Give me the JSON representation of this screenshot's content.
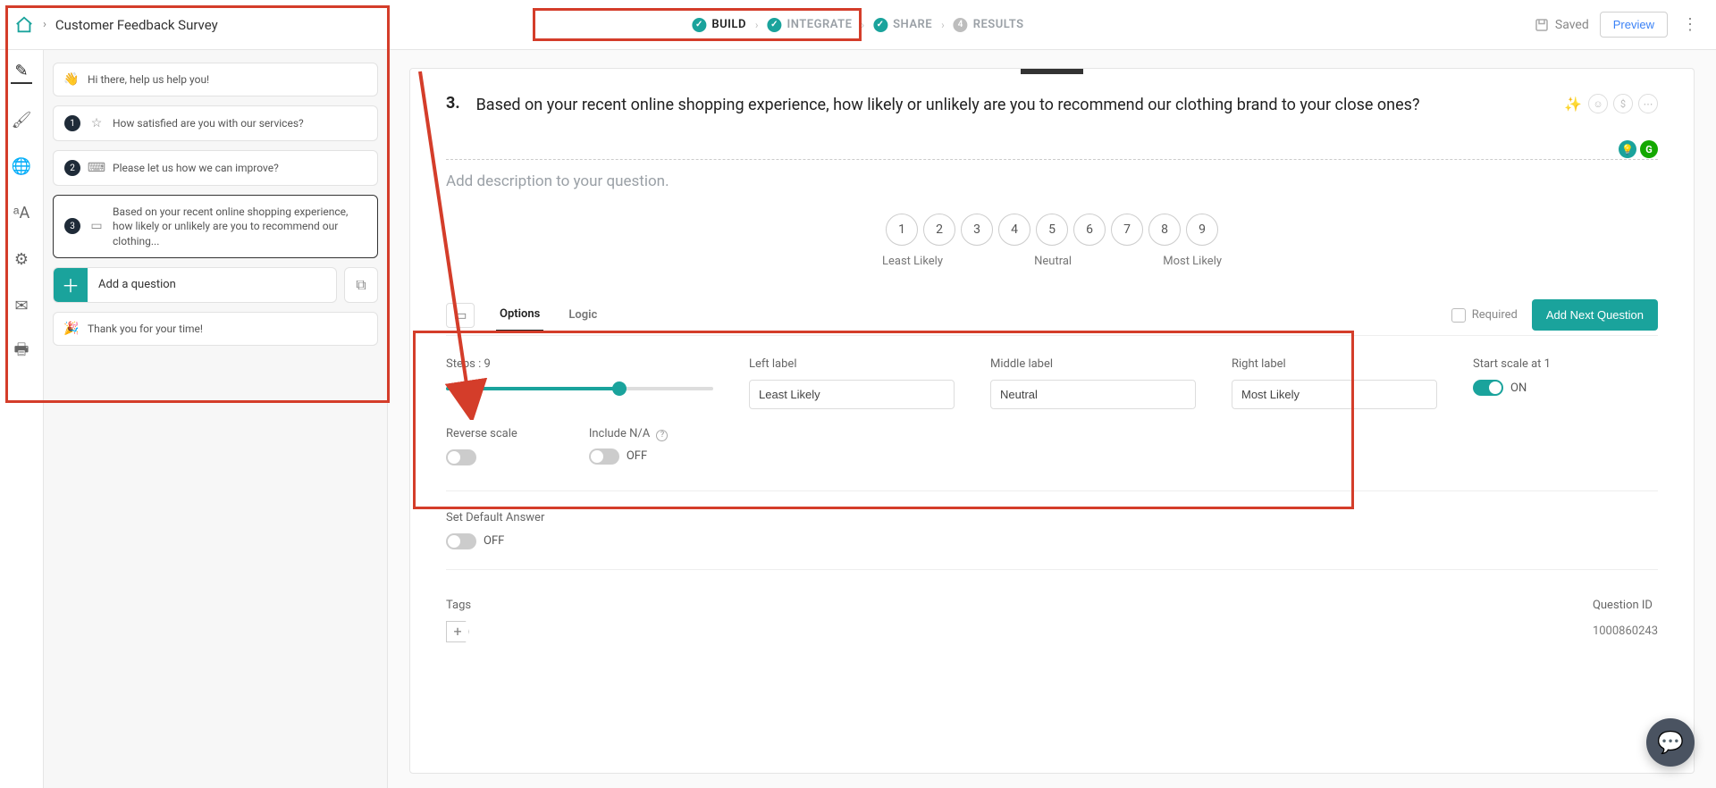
{
  "header": {
    "surveyTitle": "Customer Feedback Survey",
    "steps": [
      {
        "label": "BUILD",
        "active": true,
        "badge": "✓"
      },
      {
        "label": "INTEGRATE",
        "active": false,
        "badge": "✓"
      },
      {
        "label": "SHARE",
        "active": false,
        "badge": "✓"
      },
      {
        "label": "RESULTS",
        "active": false,
        "badge": "4"
      }
    ],
    "savedLabel": "Saved",
    "previewLabel": "Preview"
  },
  "sidebar": {
    "welcome": {
      "text": "Hi there, help us help you!"
    },
    "questions": [
      {
        "num": "1",
        "icon": "☆",
        "text": "How satisfied are you with our services?"
      },
      {
        "num": "2",
        "icon": "⌨",
        "text": "Please let us how we can improve?"
      },
      {
        "num": "3",
        "icon": "▭",
        "text": "Based on your recent online shopping experience, how likely or unlikely are you to recommend our clothing...",
        "selected": true
      }
    ],
    "addLabel": "Add a question",
    "thankyou": {
      "text": "Thank you for your time!"
    }
  },
  "editor": {
    "qNumber": "3.",
    "qText": "Based on your recent online shopping experience, how likely or unlikely are you to recommend our clothing brand to your close ones?",
    "descPlaceholder": "Add description to your question.",
    "scaleValues": [
      "1",
      "2",
      "3",
      "4",
      "5",
      "6",
      "7",
      "8",
      "9"
    ],
    "scaleLeft": "Least Likely",
    "scaleMid": "Neutral",
    "scaleRight": "Most Likely",
    "tabs": {
      "options": "Options",
      "logic": "Logic"
    },
    "requiredLabel": "Required",
    "addNextLabel": "Add Next Question",
    "opts": {
      "stepsLabel": "Steps : 9",
      "leftLabelTitle": "Left label",
      "leftLabelValue": "Least Likely",
      "midLabelTitle": "Middle label",
      "midLabelValue": "Neutral",
      "rightLabelTitle": "Right label",
      "rightLabelValue": "Most Likely",
      "startScaleTitle": "Start scale at 1",
      "startScaleState": "ON",
      "reverseTitle": "Reverse scale",
      "includeNATitle": "Include N/A",
      "includeNAState": "OFF"
    },
    "defaultAnswer": {
      "title": "Set Default Answer",
      "state": "OFF"
    },
    "tagsTitle": "Tags",
    "qidTitle": "Question ID",
    "qidValue": "1000860243"
  }
}
